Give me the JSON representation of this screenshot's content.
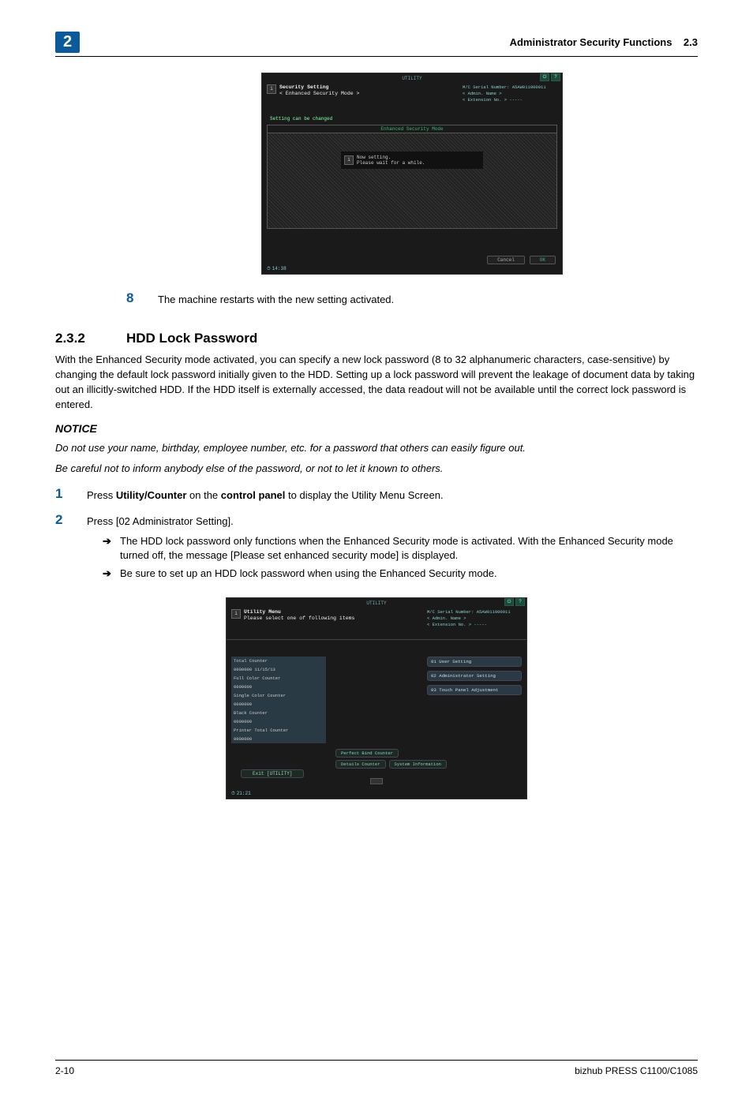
{
  "header": {
    "chapter": "2",
    "title": "Administrator Security Functions",
    "section_ref": "2.3"
  },
  "panel1": {
    "utility_label": "UTILITY",
    "title_line1": "Security Setting",
    "title_line2": "< Enhanced Security Mode >",
    "serial": "M/C Serial Number: A5AW011000011",
    "admin": "< Admin. Name >",
    "ext": "< Extension No. >  -----",
    "changed": "Setting can be changed",
    "mode_label": "Enhanced Security Mode",
    "inner_line1": "Now setting.",
    "inner_line2": "Please wait for a while.",
    "cancel": "Cancel",
    "ok": "OK",
    "time": "14:38"
  },
  "step8": {
    "num": "8",
    "text": "The machine restarts with the new setting activated."
  },
  "section": {
    "num": "2.3.2",
    "title": "HDD Lock Password",
    "para1": "With the Enhanced Security mode activated, you can specify a new lock password (8 to 32 alphanumeric characters, case-sensitive) by changing the default lock password initially given to the HDD. Setting up a lock password will prevent the leakage of document data by taking out an illicitly-switched HDD. If the HDD itself is externally accessed, the data readout will not be available until the correct lock password is entered.",
    "notice_label": "NOTICE",
    "notice1": "Do not use your name, birthday, employee number, etc. for a password that others can easily figure out.",
    "notice2": "Be careful not to inform anybody else of the password, or not to let it known to others."
  },
  "step1": {
    "num": "1",
    "pre": "Press ",
    "b1": "Utility/Counter",
    "mid": " on the ",
    "b2": "control panel",
    "post": " to display the Utility Menu Screen."
  },
  "step2": {
    "num": "2",
    "text": "Press [02 Administrator Setting].",
    "sub1": "The HDD lock password only functions when the Enhanced Security mode is activated. With the Enhanced Security mode turned off, the message [Please set enhanced security mode] is displayed.",
    "sub2": "Be sure to set up an HDD lock password when using the Enhanced Security mode.",
    "arrow": "➔"
  },
  "panel2": {
    "utility_label": "UTILITY",
    "title_line1": "Utility Menu",
    "title_line2": "Please select one of following items",
    "serial": "M/C Serial Number: A5AW011000011",
    "admin": "< Admin. Name >",
    "ext": "< Extension No. >  -----",
    "counters": [
      "Total Counter",
      "0000000   11/15/13",
      "Full Color Counter",
      "0000000",
      "Single Color Counter",
      "0000000",
      "Black Counter",
      "0000000",
      "Printer Total Counter",
      "0000000"
    ],
    "right_buttons": [
      "01 User Setting",
      "02 Administrator Setting",
      "03 Touch Panel Adjustment"
    ],
    "mid_buttons_top": "Perfect Bind Counter",
    "mid_buttons_left": "Details Counter",
    "mid_buttons_right": "System Information",
    "exit": "Exit [UTILITY]",
    "time": "21:21"
  },
  "footer": {
    "left": "2-10",
    "right": "bizhub PRESS C1100/C1085"
  }
}
